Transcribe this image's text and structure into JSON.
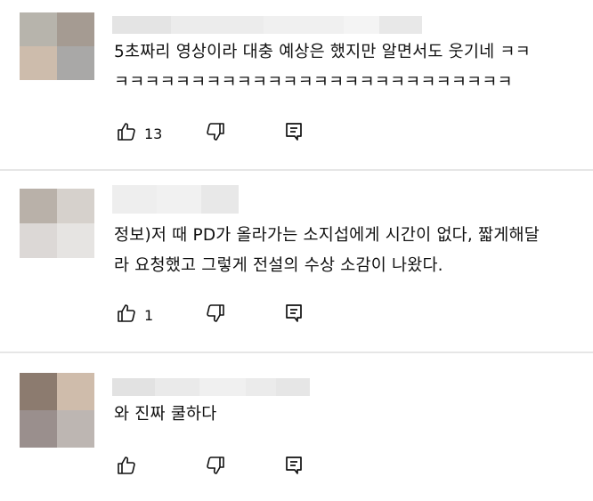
{
  "comments": [
    {
      "text": "5초짜리 영상이라 대충 예상은 했지만 알면서도 웃기네 ㅋㅋ\nㅋㅋㅋㅋㅋㅋㅋㅋㅋㅋㅋㅋㅋㅋㅋㅋㅋㅋㅋㅋㅋㅋㅋㅋㅋㅋ",
      "likes": "13",
      "avatar_colors": [
        "#b7b4ac",
        "#a59b92",
        "#cdbcac",
        "#a9a8a7"
      ],
      "name_colors": [
        "#e4e4e4",
        "#ececec",
        "#f0f0f0",
        "#f4f4f4",
        "#e8e8e8"
      ]
    },
    {
      "text": "정보)저 때 PD가 올라가는 소지섭에게 시간이 없다, 짧게해달\n라 요청했고 그렇게 전설의 수상 소감이 나왔다.",
      "likes": "1",
      "avatar_colors": [
        "#b9b1a9",
        "#d6d1cc",
        "#dcd8d6",
        "#e6e4e2"
      ],
      "name_colors": [
        "#eeeeee",
        "#f1f1f1",
        "#e8e8e8"
      ]
    },
    {
      "text": "와 진짜 쿨하다",
      "likes": "",
      "avatar_colors": [
        "#8c7b6f",
        "#cfbcab",
        "#9a8f8d",
        "#bdb6b2"
      ],
      "name_colors": [
        "#e2e2e2",
        "#eaeaea",
        "#f0f0f0",
        "#ebebeb",
        "#e6e6e6"
      ]
    }
  ]
}
